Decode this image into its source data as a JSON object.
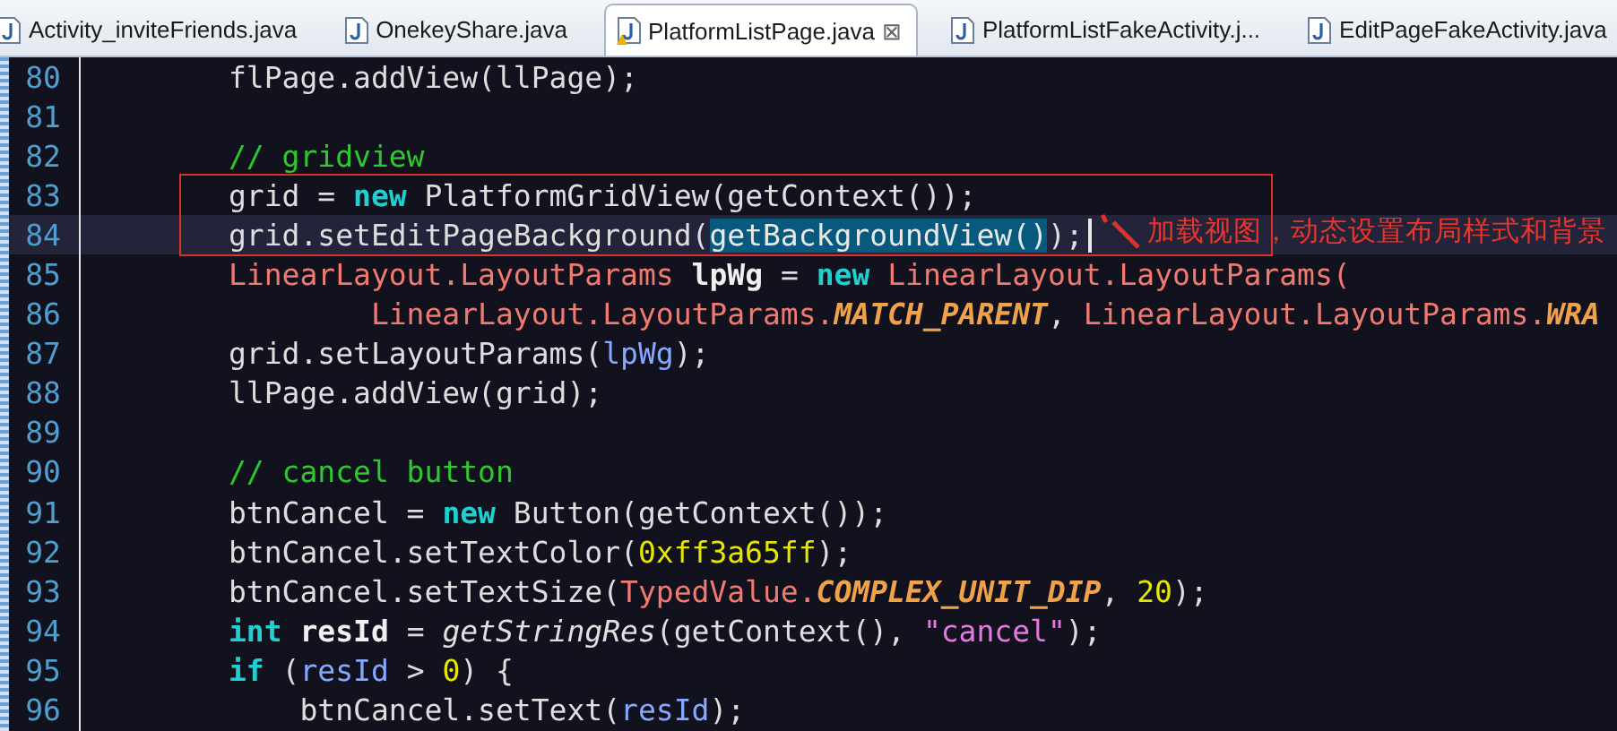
{
  "tabs": [
    {
      "label": "Activity_inviteFriends.java",
      "selected": false,
      "warning": false
    },
    {
      "label": "OnekeyShare.java",
      "selected": false,
      "warning": false
    },
    {
      "label": "PlatformListPage.java",
      "selected": true,
      "warning": true,
      "close": "⊠"
    },
    {
      "label": "PlatformListFakeActivity.j...",
      "selected": false,
      "warning": false
    },
    {
      "label": "EditPageFakeActivity.java",
      "selected": false,
      "warning": false
    }
  ],
  "lines": [
    {
      "number": "80",
      "current": false,
      "caret": false,
      "tokens": [
        {
          "kind": "plain",
          "text": "        flPage.addView(llPage);"
        }
      ]
    },
    {
      "number": "81",
      "current": false,
      "caret": false
    },
    {
      "number": "82",
      "current": false,
      "caret": false,
      "tokens": [
        {
          "kind": "comment",
          "text": "        // gridview"
        }
      ]
    },
    {
      "number": "83",
      "current": false,
      "caret": false,
      "tokens": [
        {
          "kind": "plain",
          "text": "        grid = "
        },
        {
          "kind": "keyword",
          "text": "new"
        },
        {
          "kind": "plain",
          "text": " PlatformGridView(getContext());"
        }
      ]
    },
    {
      "number": "84",
      "current": true,
      "caret": true,
      "tokens": [
        {
          "kind": "plain",
          "text": "        grid.setEditPageBackground("
        },
        {
          "kind": "selected",
          "text": "getBackgroundView()"
        },
        {
          "kind": "plain",
          "text": ");"
        }
      ]
    },
    {
      "number": "85",
      "current": false,
      "caret": false,
      "tokens": [
        {
          "kind": "type",
          "text": "        LinearLayout.LayoutParams "
        },
        {
          "kind": "local",
          "text": "lpWg"
        },
        {
          "kind": "plain",
          "text": " = "
        },
        {
          "kind": "keyword",
          "text": "new"
        },
        {
          "kind": "type",
          "text": " LinearLayout.LayoutParams("
        }
      ]
    },
    {
      "number": "86",
      "current": false,
      "caret": false,
      "tokens": [
        {
          "kind": "type",
          "text": "                LinearLayout.LayoutParams."
        },
        {
          "kind": "constant",
          "text": "MATCH_PARENT"
        },
        {
          "kind": "plain",
          "text": ", "
        },
        {
          "kind": "type",
          "text": "LinearLayout.LayoutParams."
        },
        {
          "kind": "constant",
          "text": "WRA"
        }
      ]
    },
    {
      "number": "87",
      "current": false,
      "caret": false,
      "tokens": [
        {
          "kind": "plain",
          "text": "        grid.setLayoutParams("
        },
        {
          "kind": "field",
          "text": "lpWg"
        },
        {
          "kind": "plain",
          "text": ");"
        }
      ]
    },
    {
      "number": "88",
      "current": false,
      "caret": false,
      "tokens": [
        {
          "kind": "plain",
          "text": "        llPage.addView(grid);"
        }
      ]
    },
    {
      "number": "89",
      "current": false,
      "caret": false
    },
    {
      "number": "90",
      "current": false,
      "caret": false,
      "tokens": [
        {
          "kind": "comment",
          "text": "        // cancel button"
        }
      ]
    },
    {
      "number": "91",
      "current": false,
      "caret": false,
      "tokens": [
        {
          "kind": "plain",
          "text": "        btnCancel = "
        },
        {
          "kind": "keyword",
          "text": "new"
        },
        {
          "kind": "plain",
          "text": " Button(getContext());"
        }
      ]
    },
    {
      "number": "92",
      "current": false,
      "caret": false,
      "tokens": [
        {
          "kind": "plain",
          "text": "        btnCancel.setTextColor("
        },
        {
          "kind": "number",
          "text": "0xff3a65ff"
        },
        {
          "kind": "plain",
          "text": ");"
        }
      ]
    },
    {
      "number": "93",
      "current": false,
      "caret": false,
      "tokens": [
        {
          "kind": "plain",
          "text": "        btnCancel.setTextSize("
        },
        {
          "kind": "type",
          "text": "TypedValue."
        },
        {
          "kind": "constant",
          "text": "COMPLEX_UNIT_DIP"
        },
        {
          "kind": "plain",
          "text": ", "
        },
        {
          "kind": "number",
          "text": "20"
        },
        {
          "kind": "plain",
          "text": ");"
        }
      ]
    },
    {
      "number": "94",
      "current": false,
      "caret": false,
      "tokens": [
        {
          "kind": "keyword",
          "text": "        int"
        },
        {
          "kind": "local",
          "text": " resId"
        },
        {
          "kind": "plain",
          "text": " = "
        },
        {
          "kind": "method",
          "text": "getStringRes"
        },
        {
          "kind": "plain",
          "text": "(getContext(), "
        },
        {
          "kind": "string",
          "text": "\"cancel\""
        },
        {
          "kind": "plain",
          "text": ");"
        }
      ]
    },
    {
      "number": "95",
      "current": false,
      "caret": false,
      "tokens": [
        {
          "kind": "keyword",
          "text": "        if"
        },
        {
          "kind": "plain",
          "text": " ("
        },
        {
          "kind": "field",
          "text": "resId"
        },
        {
          "kind": "plain",
          "text": " > "
        },
        {
          "kind": "number",
          "text": "0"
        },
        {
          "kind": "plain",
          "text": ") {"
        }
      ]
    },
    {
      "number": "96",
      "current": false,
      "caret": false,
      "tokens": [
        {
          "kind": "plain",
          "text": "            btnCancel.setText("
        },
        {
          "kind": "field",
          "text": "resId"
        },
        {
          "kind": "plain",
          "text": ");"
        }
      ]
    }
  ],
  "annotation": {
    "text": "加载视图，动态设置布局样式和背景"
  }
}
